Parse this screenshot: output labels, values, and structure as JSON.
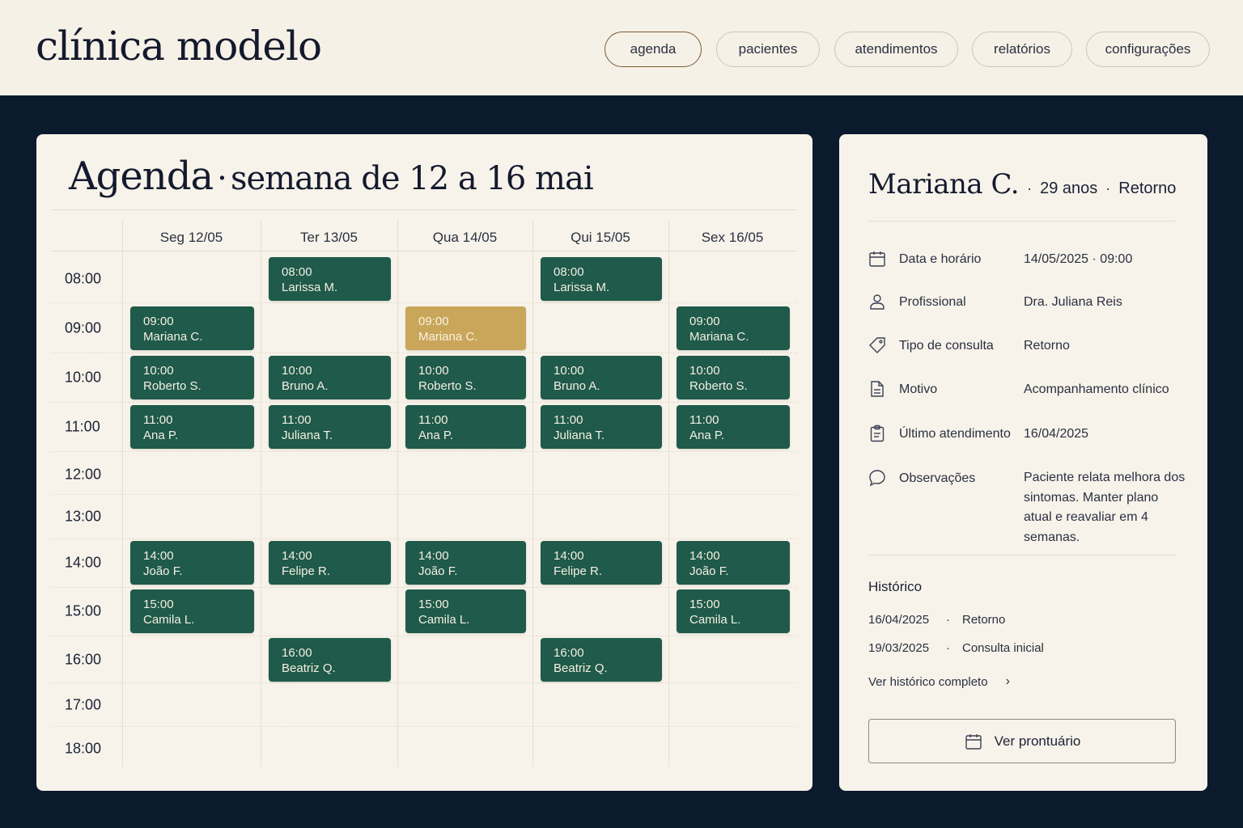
{
  "app": {
    "title": "clínica modelo"
  },
  "nav": [
    {
      "label": "agenda",
      "active": true
    },
    {
      "label": "pacientes"
    },
    {
      "label": "atendimentos"
    },
    {
      "label": "relatórios"
    },
    {
      "label": "configurações"
    }
  ],
  "calendar": {
    "title": "Agenda",
    "separator": "·",
    "subtitle": "semana de 12 a 16 mai",
    "days": [
      "Seg 12/05",
      "Ter 13/05",
      "Qua 14/05",
      "Qui 15/05",
      "Sex 16/05"
    ],
    "times": [
      "08:00",
      "09:00",
      "10:00",
      "11:00",
      "12:00",
      "13:00",
      "14:00",
      "15:00",
      "16:00",
      "17:00",
      "18:00"
    ],
    "appointments": [
      {
        "day": "Ter 13/05",
        "time": "08:00",
        "name": "Larissa M."
      },
      {
        "day": "Qui 15/05",
        "time": "08:00",
        "name": "Larissa M."
      },
      {
        "day": "Seg 12/05",
        "time": "09:00",
        "name": "Mariana C."
      },
      {
        "day": "Qua 14/05",
        "time": "09:00",
        "name": "Mariana C.",
        "selected": true
      },
      {
        "day": "Sex 16/05",
        "time": "09:00",
        "name": "Mariana C."
      },
      {
        "day": "Seg 12/05",
        "time": "10:00",
        "name": "Roberto S."
      },
      {
        "day": "Ter 13/05",
        "time": "10:00",
        "name": "Bruno A."
      },
      {
        "day": "Qua 14/05",
        "time": "10:00",
        "name": "Roberto S."
      },
      {
        "day": "Qui 15/05",
        "time": "10:00",
        "name": "Bruno A."
      },
      {
        "day": "Sex 16/05",
        "time": "10:00",
        "name": "Roberto S."
      },
      {
        "day": "Seg 12/05",
        "time": "11:00",
        "name": "Ana P."
      },
      {
        "day": "Ter 13/05",
        "time": "11:00",
        "name": "Juliana T."
      },
      {
        "day": "Qua 14/05",
        "time": "11:00",
        "name": "Ana P."
      },
      {
        "day": "Qui 15/05",
        "time": "11:00",
        "name": "Juliana T."
      },
      {
        "day": "Sex 16/05",
        "time": "11:00",
        "name": "Ana P."
      },
      {
        "day": "Seg 12/05",
        "time": "14:00",
        "name": "João F."
      },
      {
        "day": "Ter 13/05",
        "time": "14:00",
        "name": "Felipe R."
      },
      {
        "day": "Qua 14/05",
        "time": "14:00",
        "name": "João F."
      },
      {
        "day": "Qui 15/05",
        "time": "14:00",
        "name": "Felipe R."
      },
      {
        "day": "Sex 16/05",
        "time": "14:00",
        "name": "João F."
      },
      {
        "day": "Seg 12/05",
        "time": "15:00",
        "name": "Camila L."
      },
      {
        "day": "Qua 14/05",
        "time": "15:00",
        "name": "Camila L."
      },
      {
        "day": "Sex 16/05",
        "time": "15:00",
        "name": "Camila L."
      },
      {
        "day": "Ter 13/05",
        "time": "16:00",
        "name": "Beatriz Q."
      },
      {
        "day": "Qui 15/05",
        "time": "16:00",
        "name": "Beatriz Q."
      }
    ]
  },
  "patient": {
    "name": "Mariana C.",
    "separator": "·",
    "age": "29 anos",
    "type": "Retorno",
    "details": [
      {
        "icon": "calendar-icon",
        "label": "Data e horário",
        "value": "14/05/2025 · 09:00"
      },
      {
        "icon": "person-icon",
        "label": "Profissional",
        "value": "Dra. Juliana Reis"
      },
      {
        "icon": "tag-icon",
        "label": "Tipo de consulta",
        "value": "Retorno"
      },
      {
        "icon": "document-icon",
        "label": "Motivo",
        "value": "Acompanhamento clínico"
      },
      {
        "icon": "clipboard-icon",
        "label": "Último atendimento",
        "value": "16/04/2025"
      },
      {
        "icon": "chat-bubble-icon",
        "label": "Observações",
        "value": "Paciente relata melhora dos sintomas. Manter plano atual e reavaliar em 4 semanas."
      }
    ],
    "history": {
      "title": "Histórico",
      "items": [
        {
          "date": "16/04/2025",
          "separator": "·",
          "type": "Retorno"
        },
        {
          "date": "19/03/2025",
          "separator": "·",
          "type": "Consulta inicial"
        }
      ],
      "link_label": "Ver histórico completo",
      "link_icon": "chevron-right-icon"
    },
    "button": {
      "label": "Ver prontuário",
      "icon": "calendar-icon"
    }
  },
  "colors": {
    "background": "#0c1a2e",
    "header": "#f6f1e6",
    "card": "#f7f3ea",
    "appointment": "#1f5a4a",
    "appointment_selected": "#c9a65a"
  }
}
